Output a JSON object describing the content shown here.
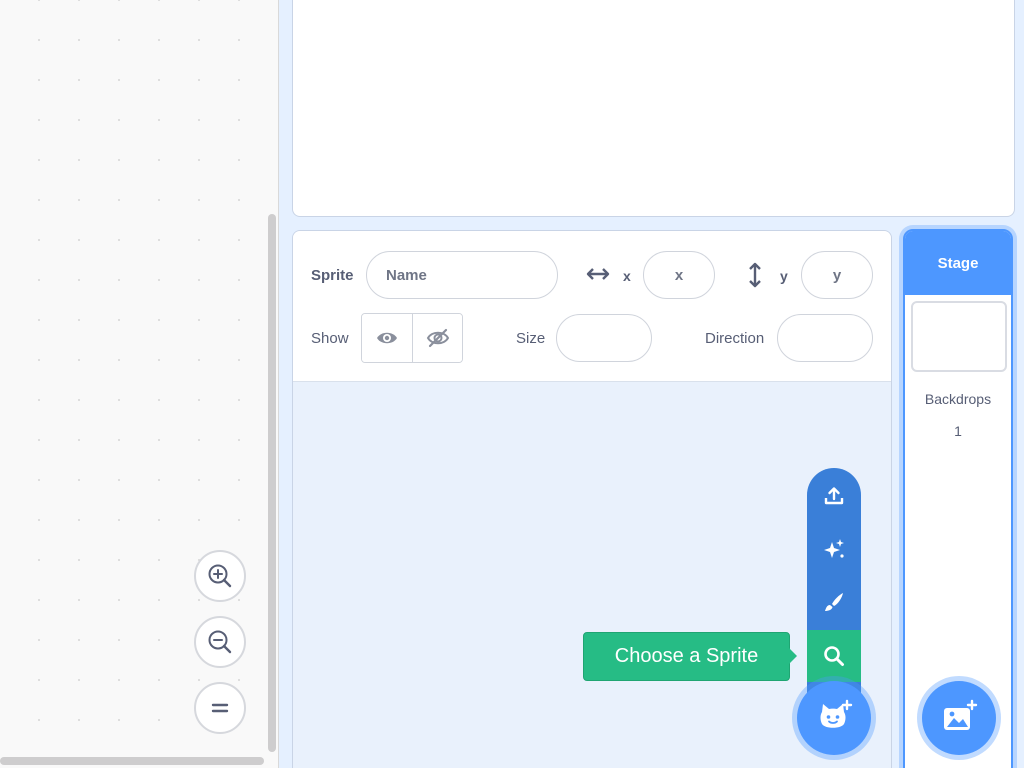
{
  "sprite_info": {
    "sprite_label": "Sprite",
    "name_placeholder": "Name",
    "x_label": "x",
    "x_placeholder": "x",
    "y_label": "y",
    "y_placeholder": "y",
    "show_label": "Show",
    "size_label": "Size",
    "direction_label": "Direction"
  },
  "sprite_menu": {
    "items": [
      "upload-icon",
      "surprise-icon",
      "paint-icon",
      "search-icon"
    ],
    "tooltip": "Choose a Sprite",
    "main_icon": "cat-plus-icon"
  },
  "stage_panel": {
    "header": "Stage",
    "backdrops_label": "Backdrops",
    "backdrops_count": "1",
    "add_backdrop_icon": "image-plus-icon"
  },
  "workspace": {
    "zoom_controls": [
      "zoom-in-icon",
      "zoom-out-icon",
      "zoom-reset-icon"
    ]
  },
  "colors": {
    "accent": "#4d97ff",
    "menu": "#3a7fd8",
    "active": "#26bc85",
    "background": "#e5f0ff"
  }
}
